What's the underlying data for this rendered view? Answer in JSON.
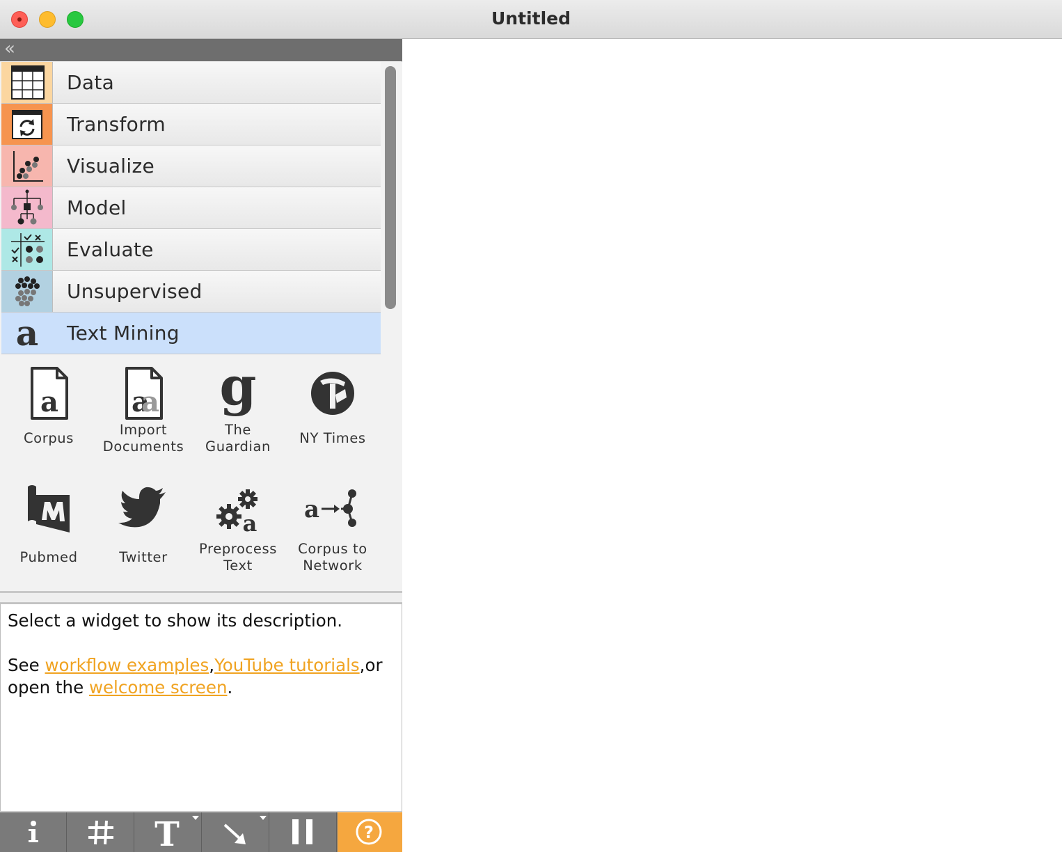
{
  "window": {
    "title": "Untitled"
  },
  "toolbox": {
    "categories": [
      {
        "label": "Data",
        "icon": "table-icon",
        "color": "#fbd6a0"
      },
      {
        "label": "Transform",
        "icon": "transform-icon",
        "color": "#f6944f"
      },
      {
        "label": "Visualize",
        "icon": "scatter-plot-icon",
        "color": "#f7b6ae"
      },
      {
        "label": "Model",
        "icon": "tree-model-icon",
        "color": "#f4b9cc"
      },
      {
        "label": "Evaluate",
        "icon": "evaluate-icon",
        "color": "#aee8e6"
      },
      {
        "label": "Unsupervised",
        "icon": "clusters-icon",
        "color": "#b2d1e1"
      },
      {
        "label": "Text Mining",
        "icon": "text-mining-icon",
        "color": "#cbe0fb"
      }
    ],
    "widgets": [
      {
        "label": "Corpus",
        "icon": "corpus-icon"
      },
      {
        "label": "Import Documents",
        "line1": "Import",
        "line2": "Documents",
        "icon": "import-documents-icon"
      },
      {
        "label": "The Guardian",
        "line1": "The",
        "line2": "Guardian",
        "icon": "guardian-icon"
      },
      {
        "label": "NY Times",
        "icon": "nytimes-icon"
      },
      {
        "label": "Pubmed",
        "icon": "pubmed-icon"
      },
      {
        "label": "Twitter",
        "icon": "twitter-icon"
      },
      {
        "label": "Preprocess Text",
        "line1": "Preprocess",
        "line2": "Text",
        "icon": "preprocess-text-icon"
      },
      {
        "label": "Corpus to Network",
        "line1": "Corpus to",
        "line2": "Network",
        "icon": "corpus-to-network-icon"
      }
    ]
  },
  "description": {
    "line1": "Select a widget to show its description.",
    "see": "See ",
    "link_workflow": "workflow examples",
    "comma1": ",",
    "link_youtube": "YouTube tutorials",
    "or": ",or",
    "open_the": "open the ",
    "link_welcome": "welcome screen",
    "period": ".",
    "link_color": "#f0a321"
  },
  "bottom_toolbar": {
    "buttons": [
      "info-icon",
      "grid-icon",
      "text-annotation-icon",
      "arrow-annotation-icon",
      "pause-icon",
      "help-icon"
    ],
    "help_color": "#f5a73f"
  }
}
